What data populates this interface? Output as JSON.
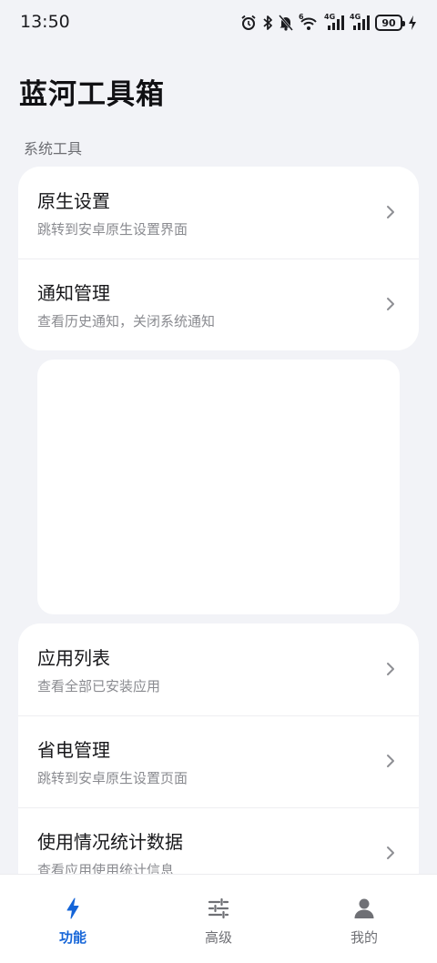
{
  "status_bar": {
    "time": "13:50",
    "icons": [
      "alarm-icon",
      "bluetooth-icon",
      "mute-icon",
      "wifi-icon",
      "signal-4g-icon",
      "signal-4g-icon"
    ],
    "wifi_label": "6",
    "sim1_label": "4G",
    "sim2_label": "4G",
    "battery": "90"
  },
  "app": {
    "title": "蓝河工具箱"
  },
  "sections": {
    "system_tools": "系统工具"
  },
  "card1": {
    "items": [
      {
        "title": "原生设置",
        "subtitle": "跳转到安卓原生设置界面"
      },
      {
        "title": "通知管理",
        "subtitle": "查看历史通知，关闭系统通知"
      }
    ]
  },
  "card2": {
    "items": [
      {
        "title": "应用列表",
        "subtitle": "查看全部已安装应用"
      },
      {
        "title": "省电管理",
        "subtitle": "跳转到安卓原生设置页面"
      },
      {
        "title": "使用情况统计数据",
        "subtitle": "查看应用使用统计信息"
      }
    ]
  },
  "nav": {
    "items": [
      {
        "label": "功能",
        "icon": "bolt-icon",
        "active": true
      },
      {
        "label": "高级",
        "icon": "sliders-icon",
        "active": false
      },
      {
        "label": "我的",
        "icon": "person-icon",
        "active": false
      }
    ]
  },
  "colors": {
    "accent": "#1565d8",
    "background": "#f2f3f7",
    "card": "#ffffff"
  }
}
